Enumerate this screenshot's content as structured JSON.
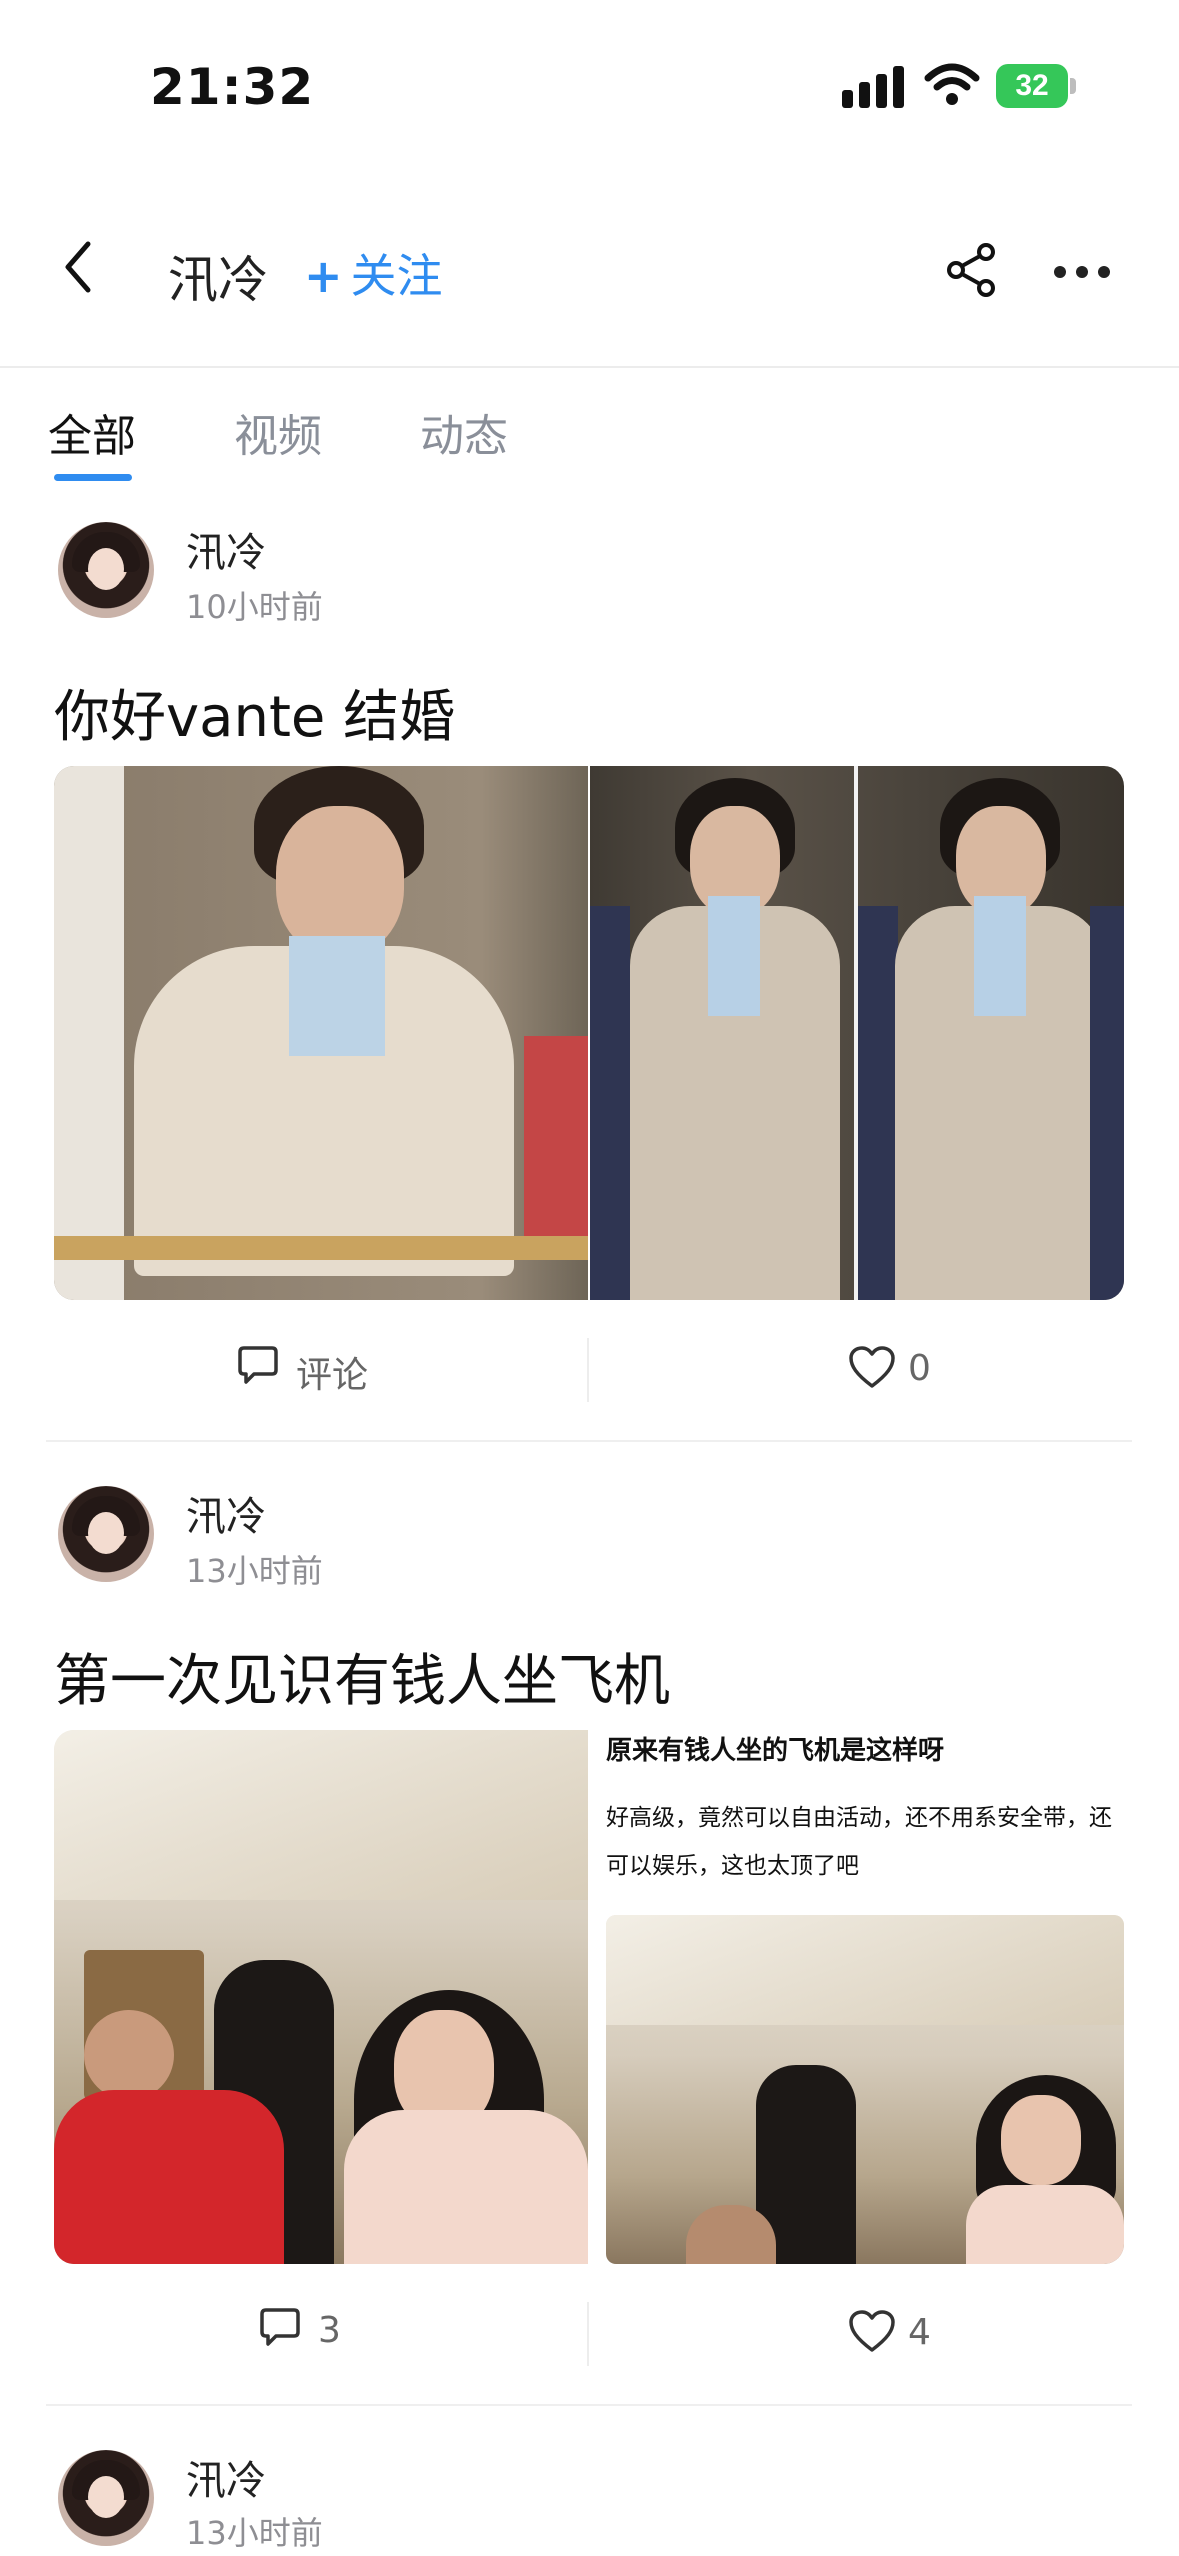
{
  "status_bar": {
    "time": "21:32",
    "battery": "32"
  },
  "header": {
    "title": "汛冷",
    "follow_label": "关注"
  },
  "tabs": [
    {
      "label": "全部",
      "active": true
    },
    {
      "label": "视频",
      "active": false
    },
    {
      "label": "动态",
      "active": false
    }
  ],
  "posts": [
    {
      "author": "汛冷",
      "time": "10小时前",
      "title": "你好vante 结婚",
      "comment_label": "评论",
      "likes": "0"
    },
    {
      "author": "汛冷",
      "time": "13小时前",
      "title": "第一次见识有钱人坐飞机",
      "image_caption": "原来有钱人坐的飞机是这样呀",
      "image_text": "好高级，竟然可以自由活动，还不用系安全带，还可以娱乐，这也太顶了吧",
      "comments": "3",
      "likes": "4"
    },
    {
      "author": "汛冷",
      "time": "13小时前"
    }
  ],
  "colors": {
    "accent": "#2f8cf0",
    "battery": "#35c759"
  }
}
